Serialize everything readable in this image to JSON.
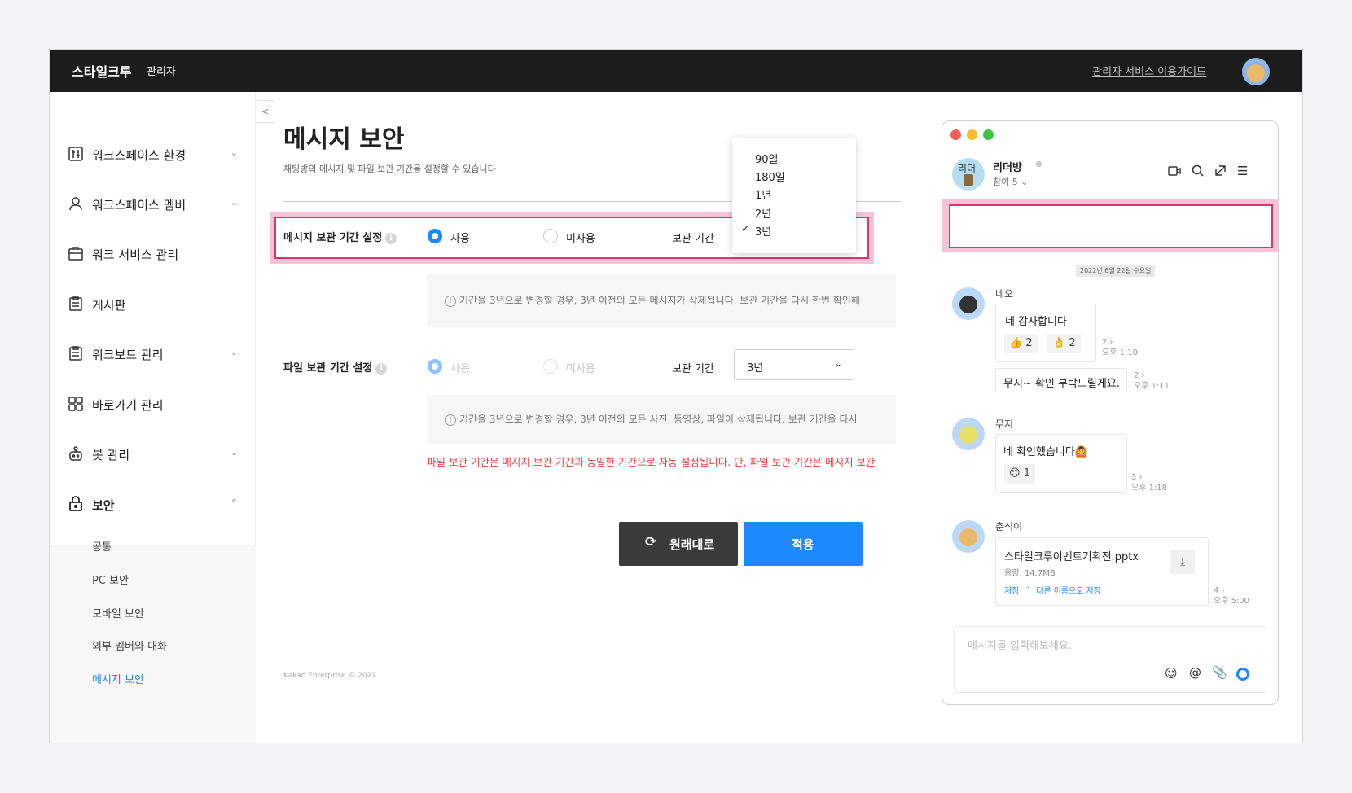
{
  "topbar": {
    "brand": "스타일크루",
    "brand_sub": "관리자",
    "guide_link": "관리자 서비스 이용가이드"
  },
  "sidebar": {
    "items": [
      {
        "label": "워크스페이스 환경"
      },
      {
        "label": "워크스페이스 멤버"
      },
      {
        "label": "워크 서비스 관리"
      },
      {
        "label": "게시판"
      },
      {
        "label": "워크보드 관리"
      },
      {
        "label": "바로가기 관리"
      },
      {
        "label": "봇 관리"
      },
      {
        "label": "보안"
      }
    ],
    "security_sub": [
      "공통",
      "PC 보안",
      "모바일 보안",
      "외부 멤버와 대화",
      "메시지 보안"
    ]
  },
  "page": {
    "title": "메시지 보안",
    "description": "채팅방의 메시지 및 파일 보관 기간을 설정할 수 있습니다"
  },
  "message_retention": {
    "label": "메시지 보관 기간 설정",
    "option_on": "사용",
    "option_off": "미사용",
    "period_label": "보관 기간",
    "dropdown_options": [
      "90일",
      "180일",
      "1년",
      "2년",
      "3년"
    ],
    "selected": "3년",
    "note": "기간을 3년으로 변경할 경우, 3년 이전의 모든 메시지가 삭제됩니다. 보관 기간을 다시 한번 확인해"
  },
  "file_retention": {
    "label": "파일 보관 기간 설정",
    "option_on": "사용",
    "option_off": "미사용",
    "period_label": "보관 기간",
    "selected": "3년",
    "note": "기간을 3년으로 변경할 경우, 3년 이전의 모든 사진, 동영상, 파일이 삭제됩니다. 보관 기간을 다시",
    "warning": "파일 보관 기간은 메시지 보관 기간과 동일한 기간으로 자동 설정됩니다. 단, 파일 보관 기간은 메시지 보관"
  },
  "buttons": {
    "reset": "원래대로",
    "apply": "적용"
  },
  "footer": {
    "copyright": "Kakao Enterprise © 2022"
  },
  "chat": {
    "room_name": "리더방",
    "participants": "참여 5",
    "avatar_label": "리더",
    "date_chip": "2022년 6월 22일 수요일",
    "messages": [
      {
        "sender": "네오",
        "text": "네 감사합니다",
        "reactions": [
          "2",
          "2"
        ],
        "unread": "2",
        "time": "오후 1:10"
      },
      {
        "sender": "",
        "text": "무지~ 확인 부탁드릴게요.",
        "unread": "2",
        "time": "오후 1:11"
      },
      {
        "sender": "무지",
        "text": "네 확인했습니다🙆",
        "reactions": [
          "1"
        ],
        "unread": "3",
        "time": "오후 1:18"
      },
      {
        "sender": "춘식이",
        "file_name": "스타일크루이벤트기획전.pptx",
        "file_size": "용량: 14.7MB",
        "save": "저장",
        "save_as": "다른 이름으로 저장",
        "unread": "4",
        "time": "오후 5:00"
      }
    ],
    "input_placeholder": "메시지를 입력해보세요."
  },
  "colors": {
    "accent": "#1e88ff",
    "highlight": "#e2336f",
    "warning": "#f03b3b",
    "topbar": "#1c1c1c"
  }
}
